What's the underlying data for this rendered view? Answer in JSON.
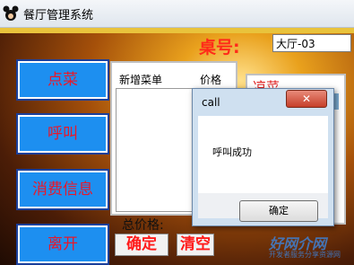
{
  "window": {
    "title": "餐厅管理系统",
    "icon": "mickey-app-icon"
  },
  "sidebar": {
    "buttons": [
      {
        "label": "点菜"
      },
      {
        "label": "呼叫"
      },
      {
        "label": "消费信息"
      },
      {
        "label": "离开"
      }
    ]
  },
  "table": {
    "label": "桌号:",
    "value": "大厅-03"
  },
  "order_panel": {
    "col_name": "新增菜单",
    "col_price": "价格"
  },
  "right_panel": {
    "title": "凉菜"
  },
  "footer": {
    "total_label": "总价格:",
    "confirm_label": "确定",
    "clear_label": "清空"
  },
  "dialog": {
    "title": "call",
    "close_symbol": "✕",
    "message": "呼叫成功",
    "ok_label": "确定"
  },
  "watermark": {
    "text": "好网介网",
    "sub": "开发者服务分享资源网"
  },
  "colors": {
    "button_bg": "#1d8ff0",
    "button_text": "#e8182a",
    "label_red": "#ff2a1a",
    "dialog_bg": "#cfe0f0"
  }
}
